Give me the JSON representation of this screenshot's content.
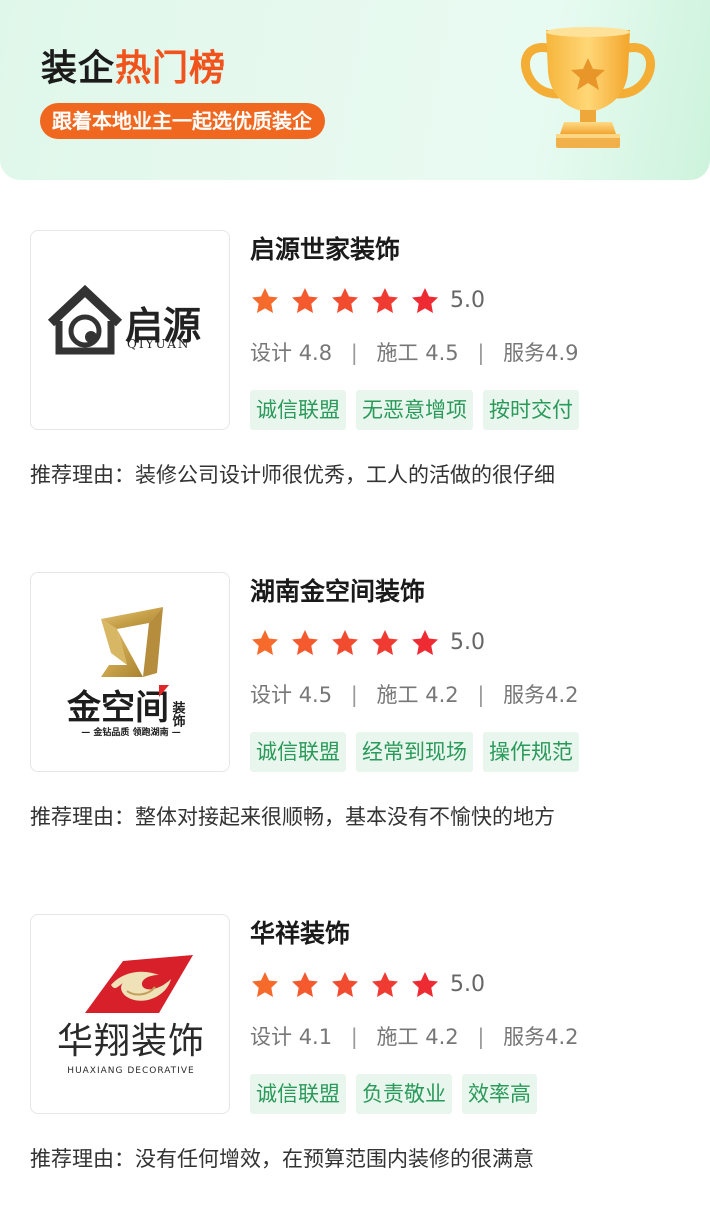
{
  "header": {
    "title_part1": "装企",
    "title_part2": "热门榜",
    "subtitle": "跟着本地业主一起选优质装企"
  },
  "icons": {
    "trophy": "trophy-icon",
    "star": "star-icon"
  },
  "colors": {
    "accent_orange": "#f0681f",
    "title_highlight": "#f0541c",
    "tag_bg": "#e9f6ee",
    "tag_text": "#2a9a5a",
    "star_orange": "#f66a2c",
    "star_red": "#ee2a33"
  },
  "companies": [
    {
      "name": "启源世家装饰",
      "rating": "5.0",
      "design_label": "设计",
      "design_score": "4.8",
      "build_label": "施工",
      "build_score": "4.5",
      "service_label": "服务",
      "service_score": "4.9",
      "sep": "|",
      "tags": [
        "诚信联盟",
        "无恶意增项",
        "按时交付"
      ],
      "reason": "推荐理由：装修公司设计师很优秀，工人的活做的很仔细",
      "logo": {
        "main": "启源",
        "sub": "QIYUAN"
      }
    },
    {
      "name": "湖南金空间装饰",
      "rating": "5.0",
      "design_label": "设计",
      "design_score": "4.5",
      "build_label": "施工",
      "build_score": "4.2",
      "service_label": "服务",
      "service_score": "4.2",
      "sep": "|",
      "tags": [
        "诚信联盟",
        "经常到现场",
        "操作规范"
      ],
      "reason": "推荐理由：整体对接起来很顺畅，基本没有不愉快的地方",
      "logo": {
        "main": "金空间",
        "side": "装饰",
        "sub": "— 金钻品质 领跑湖南 —"
      }
    },
    {
      "name": "华祥装饰",
      "rating": "5.0",
      "design_label": "设计",
      "design_score": "4.1",
      "build_label": "施工",
      "build_score": "4.2",
      "service_label": "服务",
      "service_score": "4.2",
      "sep": "|",
      "tags": [
        "诚信联盟",
        "负责敬业",
        "效率高"
      ],
      "reason": "推荐理由：没有任何增效，在预算范围内装修的很满意",
      "logo": {
        "main": "华翔装饰",
        "sub": "HUAXIANG DECORATIVE"
      }
    }
  ]
}
